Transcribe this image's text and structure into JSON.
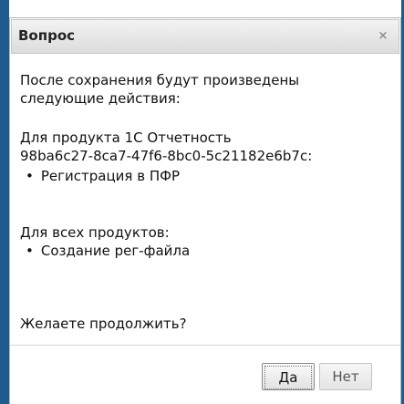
{
  "dialog": {
    "title": "Вопрос",
    "close_icon": "close-icon",
    "close_glyph": "×",
    "intro_line1": "После сохранения будут произведены",
    "intro_line2": "следующие действия:",
    "product_line1": "Для продукта 1С Отчетность",
    "product_line2": "98ba6c27-8ca7-47f6-8bc0-5c21182e6b7c:",
    "product_actions": [
      "Регистрация в ПФР"
    ],
    "all_products_heading": "Для всех продуктов:",
    "all_products_actions": [
      "Создание рег-файла"
    ],
    "question": "Желаете продолжить?",
    "buttons": {
      "yes": "Да",
      "no": "Нет"
    }
  },
  "colors": {
    "backdrop": "#1f5b8c",
    "titlebar_top": "#f3f3f3",
    "titlebar_bottom": "#dcdcdc"
  }
}
